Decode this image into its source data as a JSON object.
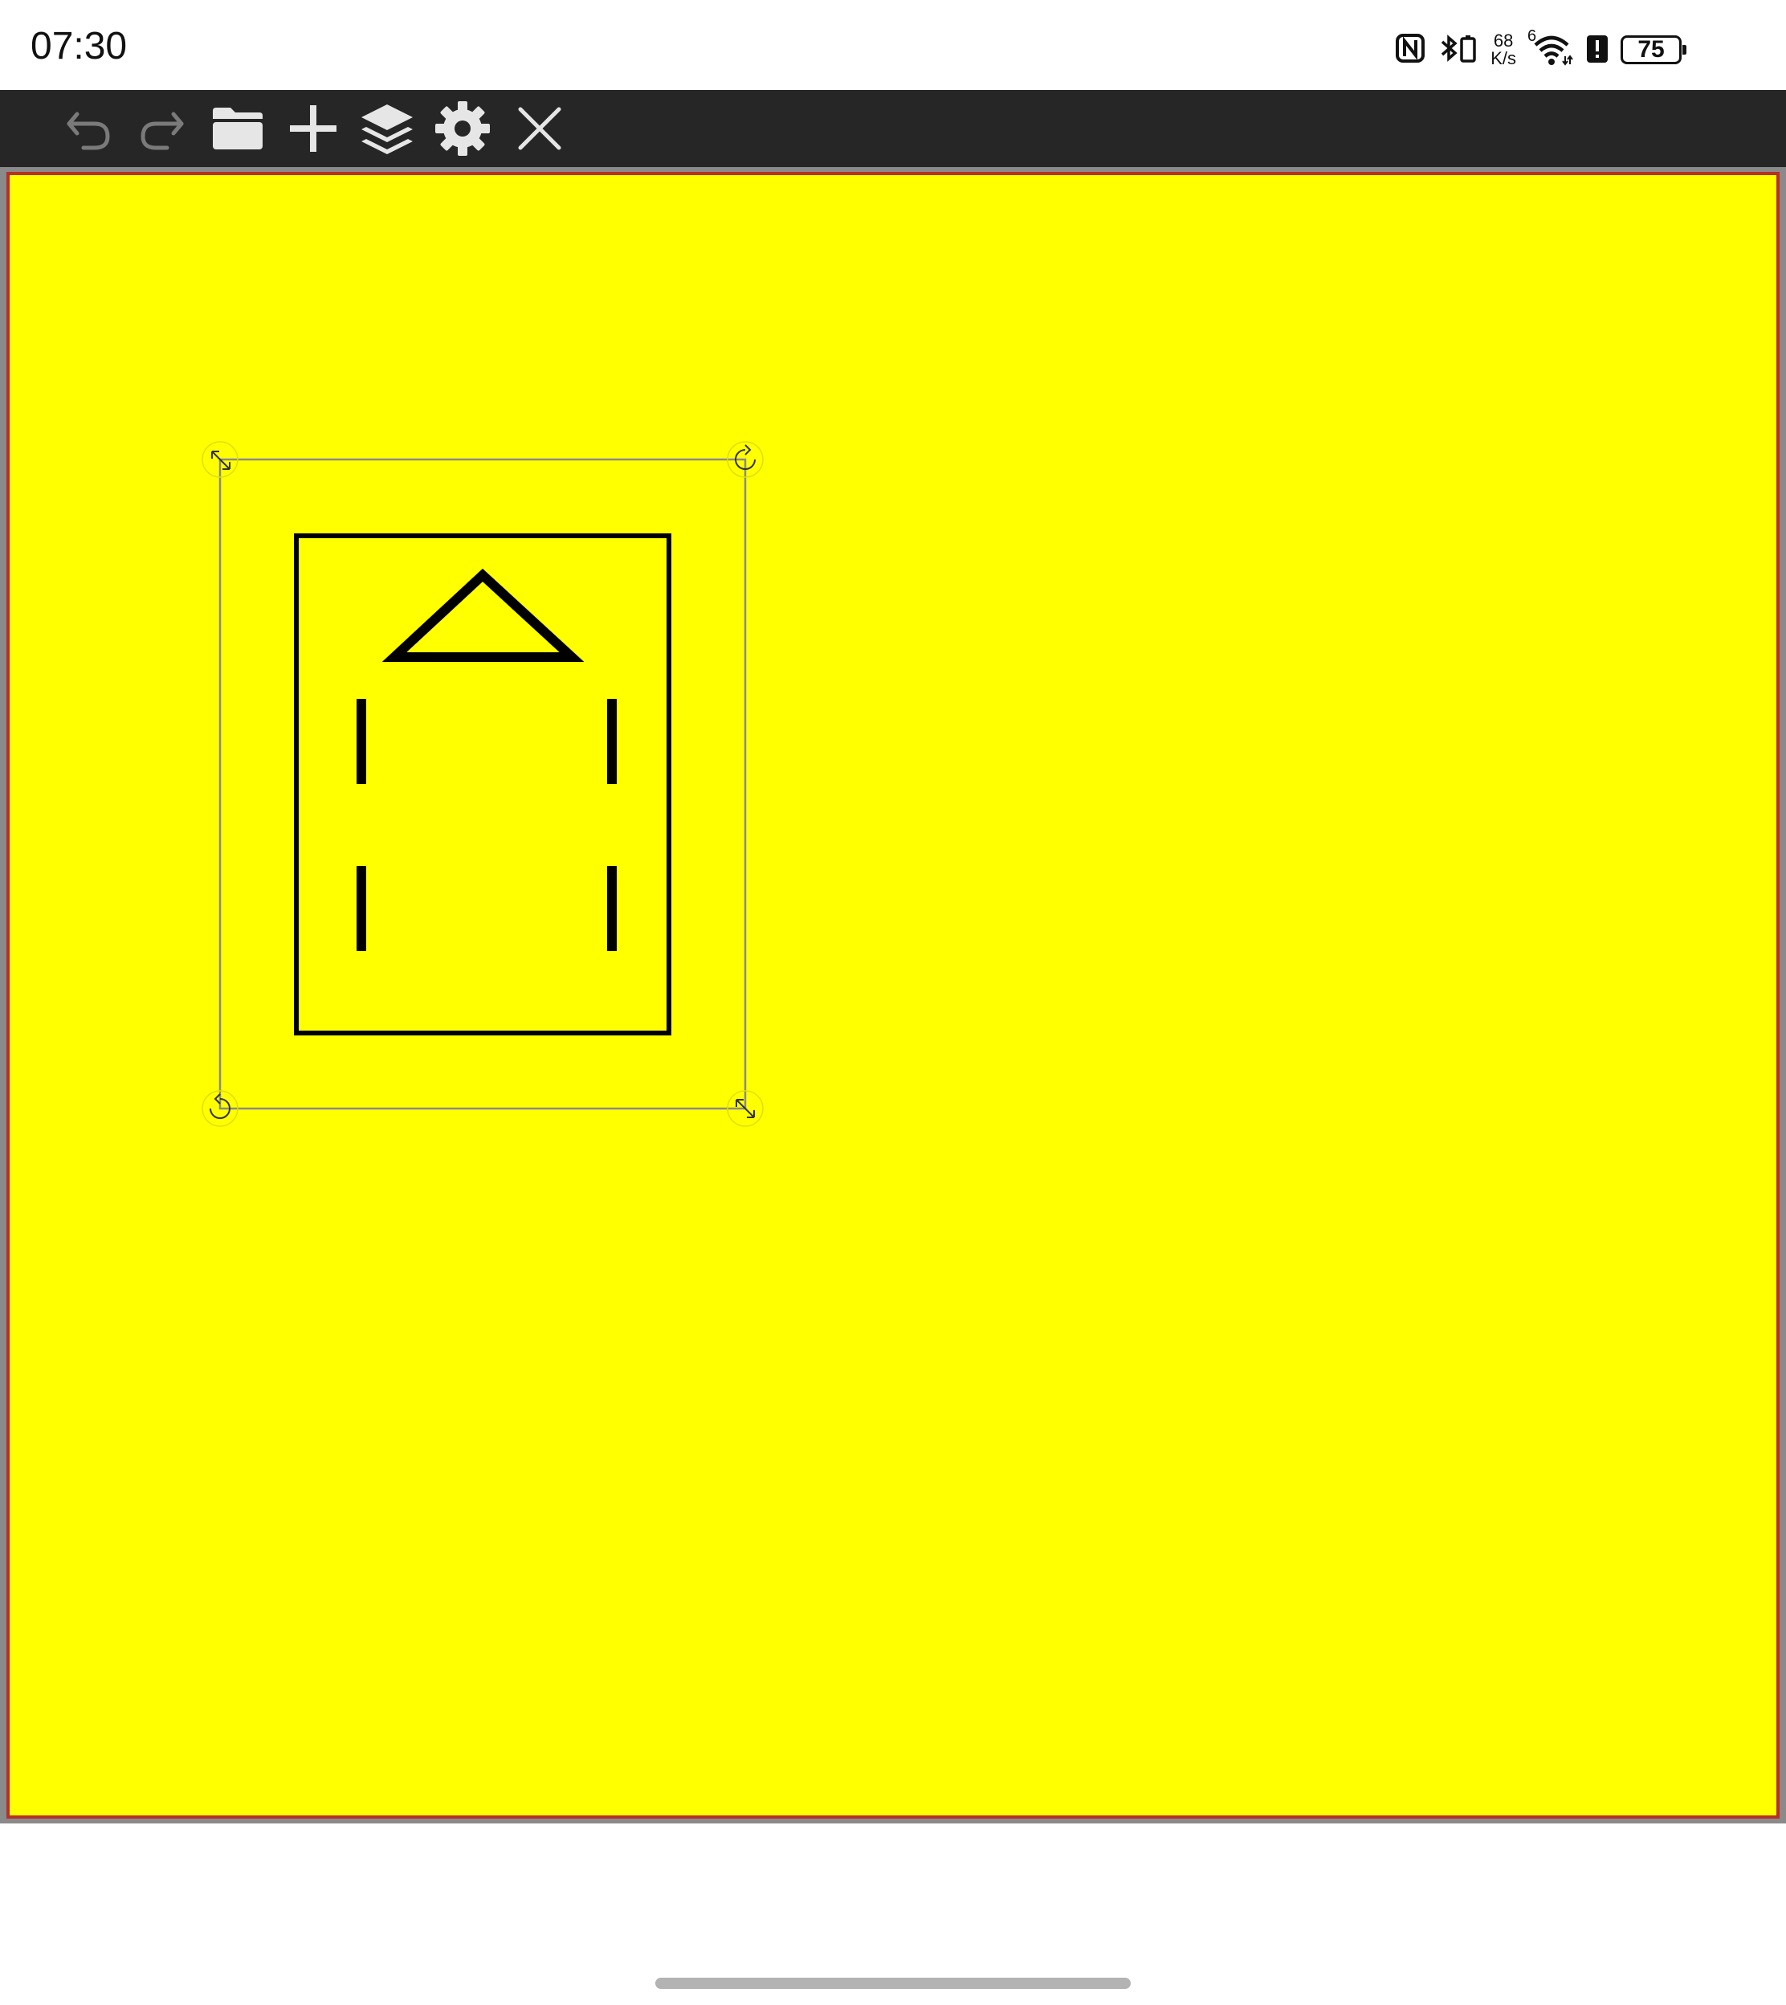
{
  "status_bar": {
    "time": "07:30",
    "net_speed_value": "68",
    "net_speed_unit": "K/s",
    "signal_label": "6",
    "battery_level": "75"
  },
  "toolbar": {
    "tools": [
      {
        "name": "undo-icon",
        "enabled": false
      },
      {
        "name": "redo-icon",
        "enabled": false
      },
      {
        "name": "folder-icon",
        "enabled": true
      },
      {
        "name": "plus-icon",
        "enabled": true
      },
      {
        "name": "layers-icon",
        "enabled": true
      },
      {
        "name": "gear-icon",
        "enabled": true
      },
      {
        "name": "close-icon",
        "enabled": true
      }
    ]
  },
  "canvas": {
    "background_color": "#ffff00",
    "border_color": "#b5302a",
    "selection_handles": [
      "scale-handle-top-left",
      "rotate-handle-top-right",
      "rotate-handle-bottom-left",
      "scale-handle-bottom-right"
    ]
  },
  "colors": {
    "toolbar_bg": "#262626",
    "icon_enabled": "#e6e6e6",
    "icon_disabled": "#7a7a7a",
    "selection_outline": "#8a8a8a",
    "shape_stroke": "#000000"
  }
}
